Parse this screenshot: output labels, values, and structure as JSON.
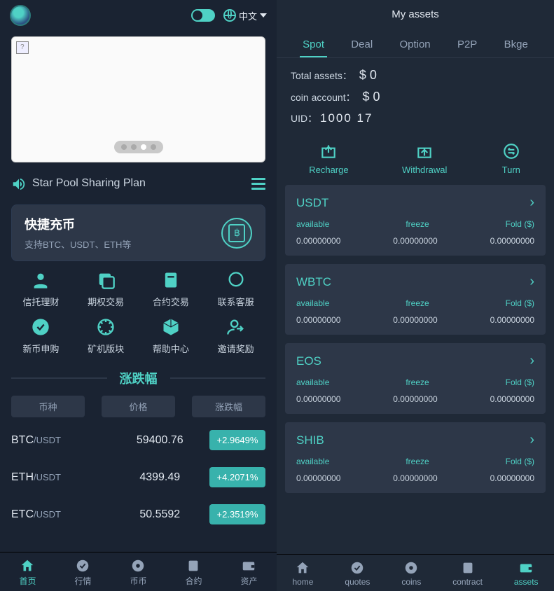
{
  "left": {
    "lang": "中文",
    "banner_active_dot": 2,
    "announcement": "Star Pool Sharing Plan",
    "deposit": {
      "title": "快捷充币",
      "subtitle": "支持BTC、USDT、ETH等"
    },
    "features": [
      "信托理财",
      "期权交易",
      "合约交易",
      "联系客服",
      "新币申购",
      "矿机版块",
      "帮助中心",
      "邀请奖励"
    ],
    "market_section_title": "涨跌幅",
    "market_headers": [
      "币种",
      "价格",
      "涨跌幅"
    ],
    "market_rows": [
      {
        "sym": "BTC",
        "base": "/USDT",
        "price": "59400.76",
        "change": "+2.9649%"
      },
      {
        "sym": "ETH",
        "base": "/USDT",
        "price": "4399.49",
        "change": "+4.2071%"
      },
      {
        "sym": "ETC",
        "base": "/USDT",
        "price": "50.5592",
        "change": "+2.3519%"
      }
    ],
    "nav": [
      "首页",
      "行情",
      "币币",
      "合约",
      "资产"
    ],
    "nav_active": 0
  },
  "right": {
    "title": "My assets",
    "tabs": [
      "Spot",
      "Deal",
      "Option",
      "P2P",
      "Bkge"
    ],
    "tab_active": 0,
    "total_label": "Total assets：",
    "total_val": "$ 0",
    "account_label": "coin account：",
    "account_val": "$ 0",
    "uid_label": "UID：",
    "uid_val": "1000 17",
    "actions": [
      "Recharge",
      "Withdrawal",
      "Turn"
    ],
    "col_labels": [
      "available",
      "freeze",
      "Fold ($)"
    ],
    "coins": [
      {
        "name": "USDT",
        "available": "0.00000000",
        "freeze": "0.00000000",
        "fold": "0.00000000"
      },
      {
        "name": "WBTC",
        "available": "0.00000000",
        "freeze": "0.00000000",
        "fold": "0.00000000"
      },
      {
        "name": "EOS",
        "available": "0.00000000",
        "freeze": "0.00000000",
        "fold": "0.00000000"
      },
      {
        "name": "SHIB",
        "available": "0.00000000",
        "freeze": "0.00000000",
        "fold": "0.00000000"
      }
    ],
    "nav": [
      "home",
      "quotes",
      "coins",
      "contract",
      "assets"
    ],
    "nav_active": 4
  },
  "colors": {
    "accent": "#4fd1c5"
  }
}
